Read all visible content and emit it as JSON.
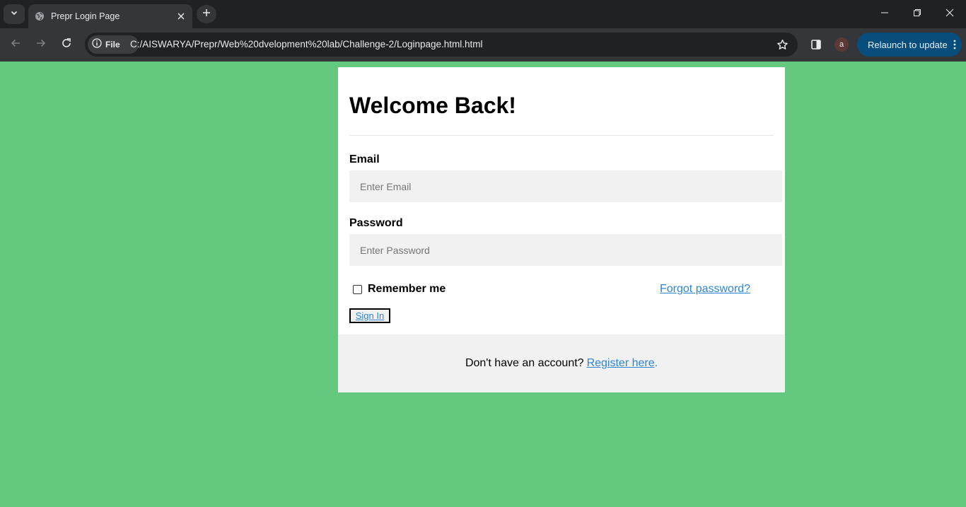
{
  "browser": {
    "tab": {
      "title": "Prepr Login Page",
      "favicon": "globe-icon"
    },
    "address": {
      "chip_label": "File",
      "url": "C:/AISWARYA/Prepr/Web%20dvelopment%20lab/Challenge-2/Loginpage.html.html"
    },
    "profile_initial": "a",
    "relaunch_label": "Relaunch to update",
    "colors": {
      "tabbar": "#202124",
      "toolbar": "#35363a",
      "relaunch": "#074e7d"
    }
  },
  "page": {
    "background": "#64c97f",
    "heading": "Welcome Back!",
    "email": {
      "label": "Email",
      "placeholder": "Enter Email",
      "value": ""
    },
    "password": {
      "label": "Password",
      "placeholder": "Enter Password",
      "value": ""
    },
    "remember_label": "Remember me",
    "remember_checked": false,
    "forgot_link": "Forgot password?",
    "signin_label": "Sign In",
    "footer": {
      "text": "Don't have an account?",
      "link": "Register here",
      "trailing": "."
    },
    "link_color": "#2f84d6"
  }
}
